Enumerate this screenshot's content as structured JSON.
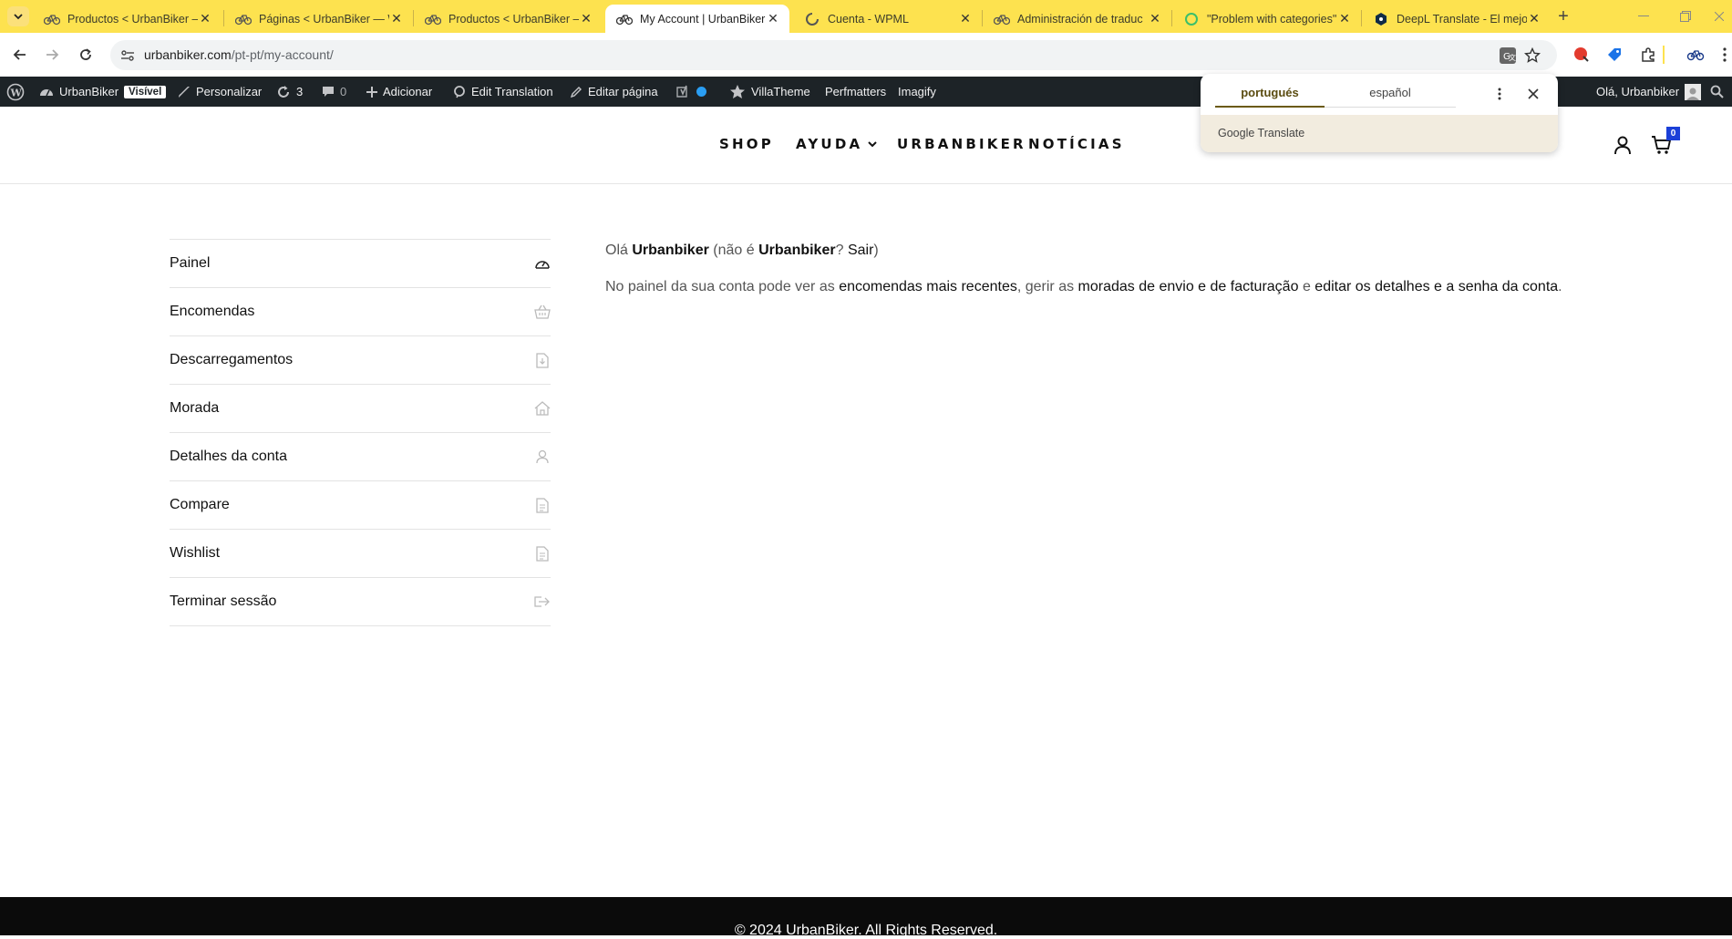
{
  "browser": {
    "tabs": [
      {
        "title": "Productos < UrbanBiker —",
        "favicon": "bike-icon"
      },
      {
        "title": "Páginas < UrbanBiker — W",
        "favicon": "bike-icon"
      },
      {
        "title": "Productos < UrbanBiker —",
        "favicon": "bike-icon"
      },
      {
        "title": "My Account | UrbanBiker",
        "favicon": "bike-icon",
        "active": true
      },
      {
        "title": "Cuenta - WPML",
        "favicon": "wpml-icon"
      },
      {
        "title": "Administración de traduc",
        "favicon": "bike-icon"
      },
      {
        "title": "\"Problem with categories\"",
        "favicon": "ring-icon"
      },
      {
        "title": "DeepL Translate - El mejo",
        "favicon": "deepl-icon"
      }
    ],
    "url_host": "urbanbiker.com",
    "url_path": "/pt-pt/my-account/",
    "accent": "#fde24f"
  },
  "adminbar": {
    "site_name": "UrbanBiker",
    "visibility_badge": "Visível",
    "customize": "Personalizar",
    "updates_count": "3",
    "comments_count": "0",
    "add_new": "Adicionar",
    "edit_translation": "Edit Translation",
    "edit_page": "Editar página",
    "villatheme": "VillaTheme",
    "perfmatters": "Perfmatters",
    "imagify": "Imagify",
    "greeting": "Olá, Urbanbiker"
  },
  "translate_popup": {
    "lang_active": "portugués",
    "lang_other": "español",
    "brand": "Google Translate"
  },
  "header": {
    "nav": [
      {
        "label": "SHOP"
      },
      {
        "label": "AYUDA",
        "has_dropdown": true
      },
      {
        "label": "URBANBIKER"
      },
      {
        "label": "NOTÍCIAS"
      }
    ],
    "cart_count": "0"
  },
  "account": {
    "menu": [
      {
        "label": "Painel",
        "icon": "dashboard-icon"
      },
      {
        "label": "Encomendas",
        "icon": "basket-icon"
      },
      {
        "label": "Descarregamentos",
        "icon": "download-file-icon"
      },
      {
        "label": "Morada",
        "icon": "home-icon"
      },
      {
        "label": "Detalhes da conta",
        "icon": "user-icon"
      },
      {
        "label": "Compare",
        "icon": "document-icon"
      },
      {
        "label": "Wishlist",
        "icon": "document-icon"
      },
      {
        "label": "Terminar sessão",
        "icon": "logout-icon"
      }
    ],
    "hello_prefix": "Olá",
    "hello_name": "Urbanbiker",
    "hello_mid": "(não é",
    "hello_name2": "Urbanbiker",
    "hello_q": "?",
    "logout_link": "Sair",
    "hello_end": ")",
    "dash_text_1": "No painel da sua conta pode ver as",
    "dash_link_orders": "encomendas mais recentes",
    "dash_text_2": ", gerir as",
    "dash_link_addresses": "moradas de envio e de facturação",
    "dash_text_3": "e",
    "dash_link_account": "editar os detalhes e a senha da conta",
    "dash_text_4": "."
  },
  "footer": {
    "copyright": "© 2024 UrbanBiker. All Rights Reserved."
  }
}
